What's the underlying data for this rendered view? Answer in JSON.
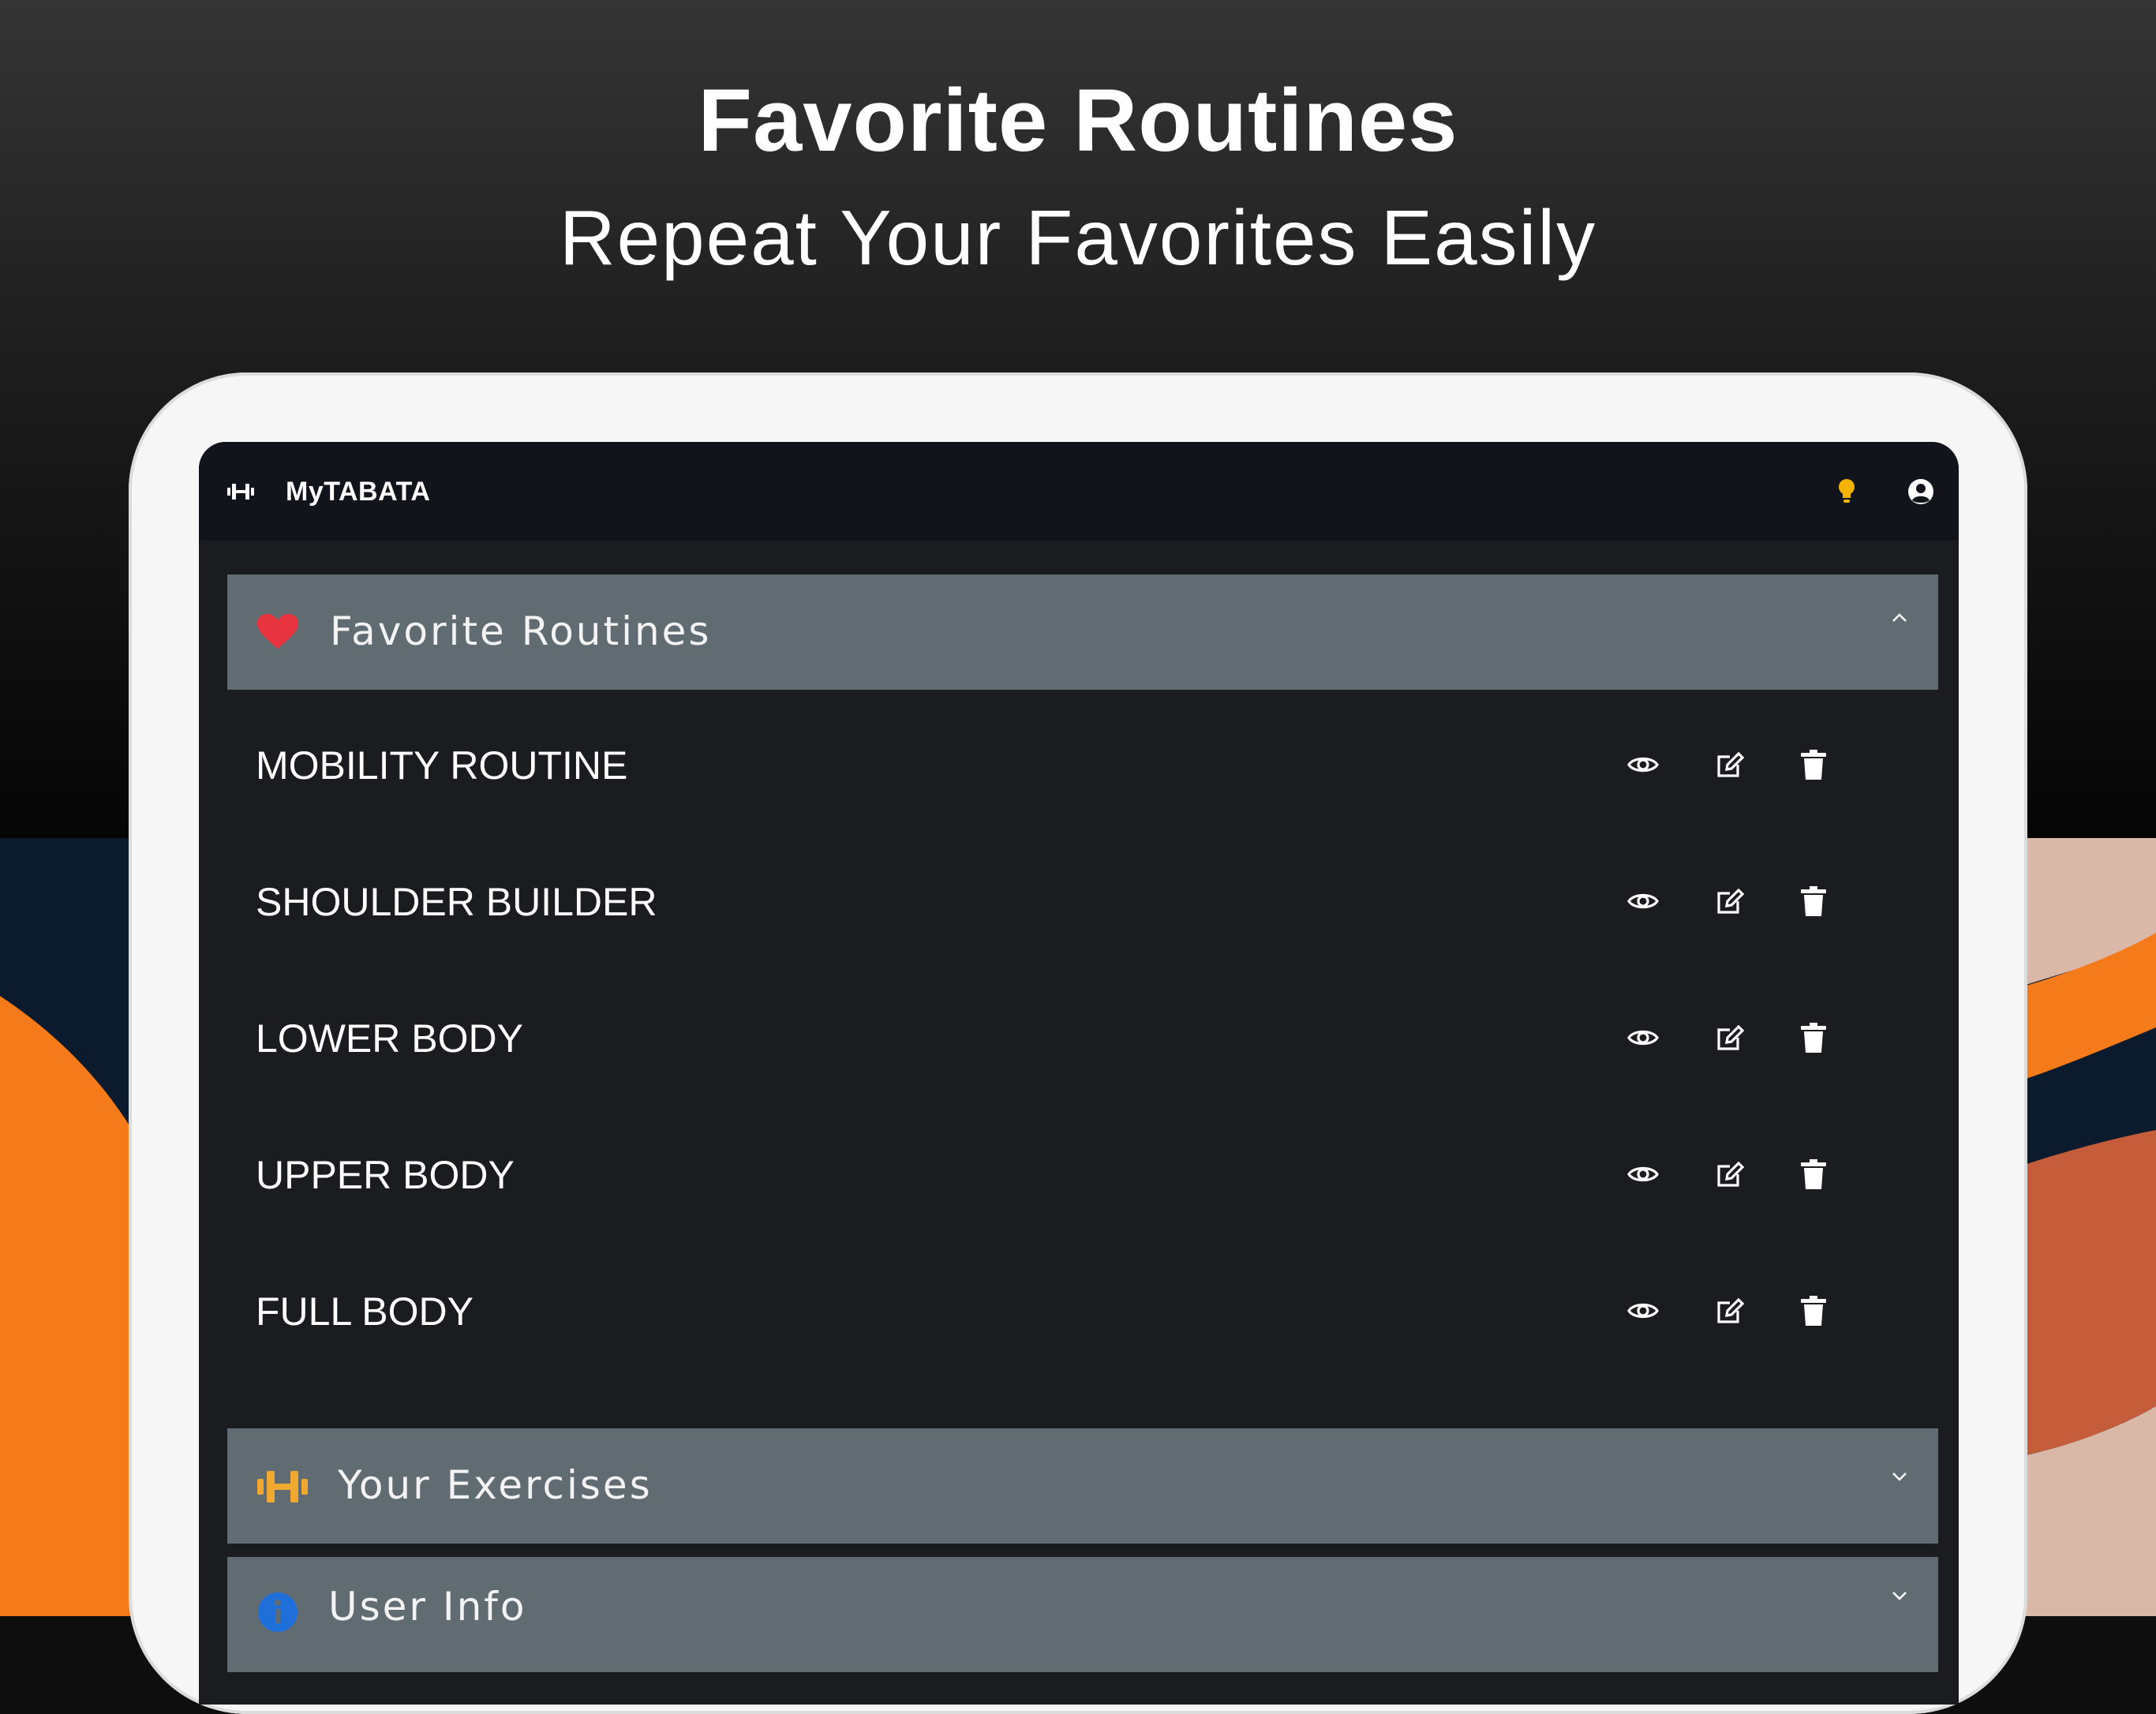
{
  "promo": {
    "headline": "Favorite Routines",
    "subheadline": "Repeat Your Favorites Easily"
  },
  "app": {
    "title": "MyTABATA",
    "logo_icon": "dumbbell-icon",
    "actions": [
      "lightbulb-icon",
      "account-circle-icon"
    ]
  },
  "panels": {
    "favorites": {
      "label": "Favorite Routines",
      "icon": "heart-icon",
      "expanded": true
    },
    "exercises": {
      "label": "Your Exercises",
      "icon": "dumbbell-icon",
      "expanded": false
    },
    "user_info": {
      "label": "User Info",
      "icon": "info-icon",
      "expanded": false
    }
  },
  "routines": [
    {
      "name": "MOBILITY ROUTINE"
    },
    {
      "name": "SHOULDER BUILDER"
    },
    {
      "name": "LOWER BODY"
    },
    {
      "name": "UPPER BODY"
    },
    {
      "name": "FULL BODY"
    }
  ],
  "row_actions": [
    "eye-icon",
    "edit-icon",
    "trash-icon"
  ],
  "colors": {
    "accent_heart": "#e8343f",
    "accent_dumbbell": "#f0a830",
    "accent_info": "#1e6fd9",
    "bulb": "#f4b400",
    "panel_header": "#616c72",
    "screen_bg": "#1b1c20",
    "appbar_bg": "#11141b"
  }
}
